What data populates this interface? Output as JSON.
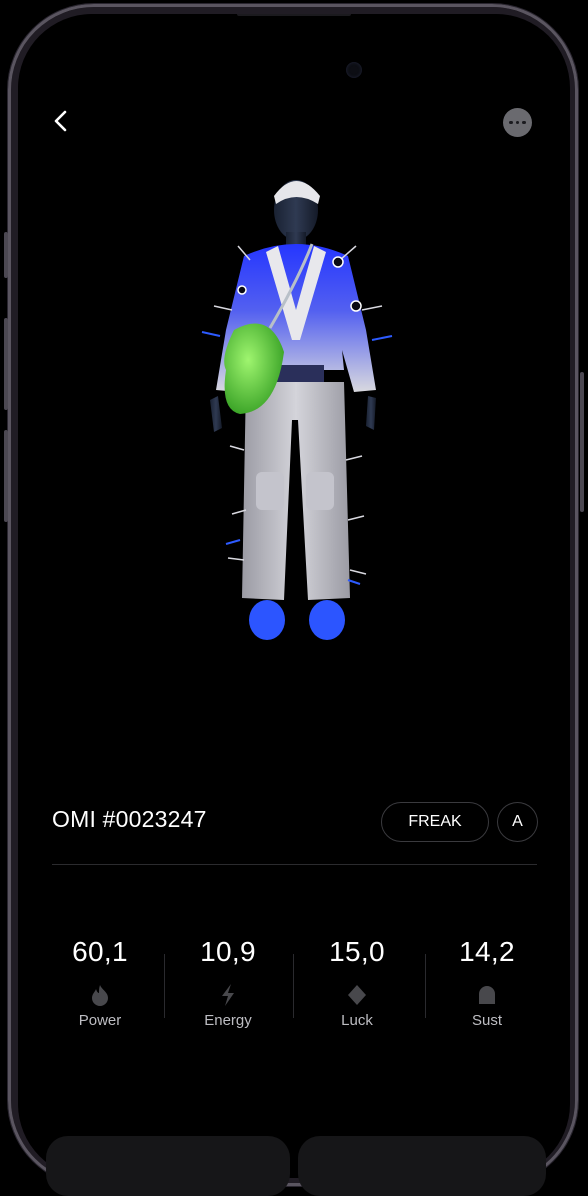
{
  "nav": {
    "back_icon": "chevron-left-icon",
    "more_icon": "more-dots-icon"
  },
  "item": {
    "title": "OMI #0023247",
    "tag": "FREAK",
    "grade": "A"
  },
  "stats": [
    {
      "value": "60,1",
      "label": "Power",
      "icon": "flame-icon"
    },
    {
      "value": "10,9",
      "label": "Energy",
      "icon": "bolt-icon"
    },
    {
      "value": "15,0",
      "label": "Luck",
      "icon": "diamond-icon"
    },
    {
      "value": "14,2",
      "label": "Sust",
      "icon": "shield-icon"
    }
  ],
  "colors": {
    "background": "#000000",
    "stat_icon": "#48484c",
    "pill_border": "#3a3a3e",
    "jacket_blue": "#2e45ff",
    "bag_green": "#58d33a",
    "shoes_blue": "#2f5dff"
  }
}
